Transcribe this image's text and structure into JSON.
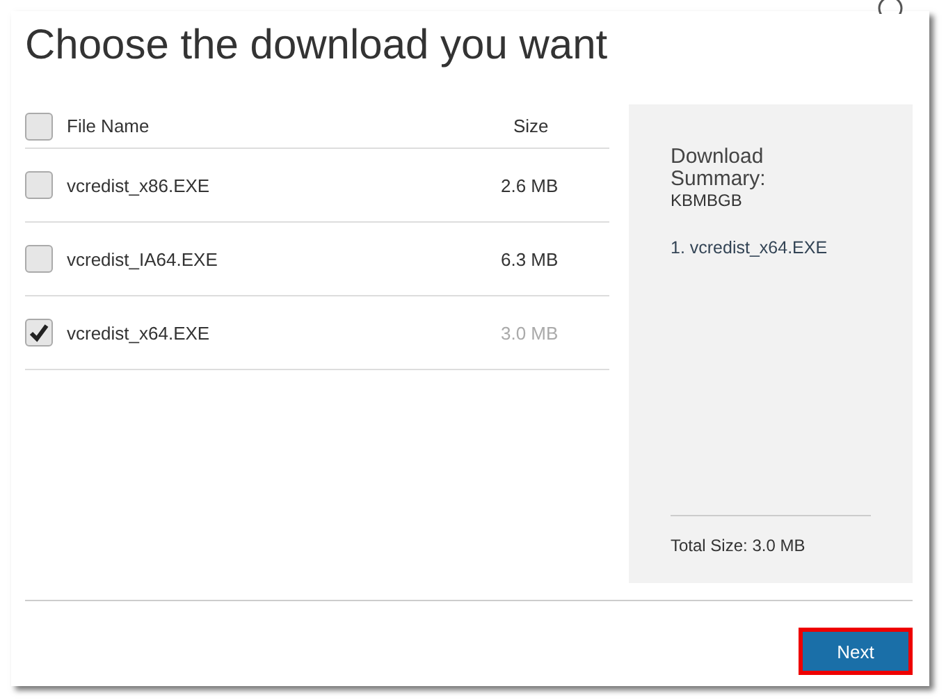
{
  "dialog": {
    "title": "Choose the download you want"
  },
  "table": {
    "select_all": {
      "checked": false
    },
    "columns": [
      "File Name",
      "Size"
    ],
    "rows": [
      {
        "name": "vcredist_x86.EXE",
        "size": "2.6 MB",
        "selected": false
      },
      {
        "name": "vcredist_IA64.EXE",
        "size": "6.3 MB",
        "selected": false
      },
      {
        "name": "vcredist_x64.EXE",
        "size": "3.0 MB",
        "selected": true
      }
    ]
  },
  "summary": {
    "heading": "Download Summary:",
    "code": "KBMBGB",
    "items": [
      "1. vcredist_x64.EXE"
    ],
    "total": "Total Size: 3.0 MB"
  },
  "next_button": {
    "label": "Next",
    "highlighted": true
  }
}
